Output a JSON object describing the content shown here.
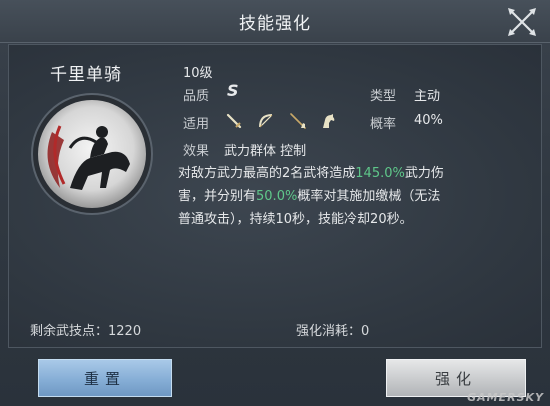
{
  "header": {
    "title": "技能强化"
  },
  "skill": {
    "name": "千里单骑",
    "level": "10级",
    "quality_label": "品质",
    "quality_value": "S",
    "type_label": "类型",
    "type_value": "主动",
    "applicable_label": "适用",
    "weapons": [
      "sword-icon",
      "bow-icon",
      "spear-icon",
      "horse-icon"
    ],
    "chance_label": "概率",
    "chance_value": "40%",
    "effect_label": "效果",
    "effect_value": "武力群体 控制",
    "desc_1": "对敌方武力最高的2名武将造成",
    "desc_hl_1": "145.0%",
    "desc_2": "武力伤害，并分别有",
    "desc_hl_2": "50.0%",
    "desc_3": "概率对其施加缴械（无法普通攻击），持续10秒，技能冷却20秒。",
    "highlight_color": "#5fc78a"
  },
  "footer": {
    "remaining_label": "剩余武技点：1220",
    "cost_label": "强化消耗：0"
  },
  "buttons": {
    "reset": "重置",
    "upgrade": "强化"
  },
  "watermark": "GAMERSKY"
}
